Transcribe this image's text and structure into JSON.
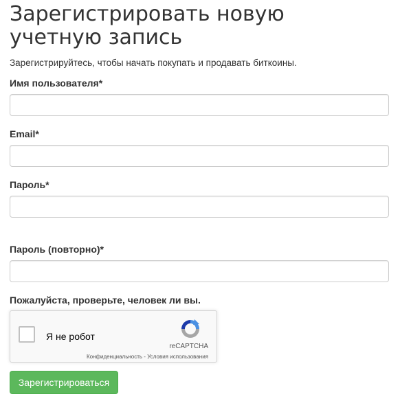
{
  "form": {
    "title": "Зарегистрировать новую учетную запись",
    "subtitle": "Зарегистрируйтесь, чтобы начать покупать и продавать биткоины.",
    "fields": {
      "username": {
        "label": "Имя пользователя*",
        "value": ""
      },
      "email": {
        "label": "Email*",
        "value": ""
      },
      "password": {
        "label": "Пароль*",
        "value": ""
      },
      "password_repeat": {
        "label": "Пароль (повторно)*",
        "value": ""
      }
    },
    "captcha_prompt": "Пожалуйста, проверьте, человек ли вы.",
    "submit_label": "Зарегистрироваться"
  },
  "captcha": {
    "checkbox_label": "Я не робот",
    "brand": "reCAPTCHA",
    "links": "Конфиденциальность - Условия использования",
    "icon": "recaptcha-logo-icon"
  },
  "colors": {
    "button": "#5cb85c",
    "border": "#cccccc",
    "text": "#333333"
  }
}
